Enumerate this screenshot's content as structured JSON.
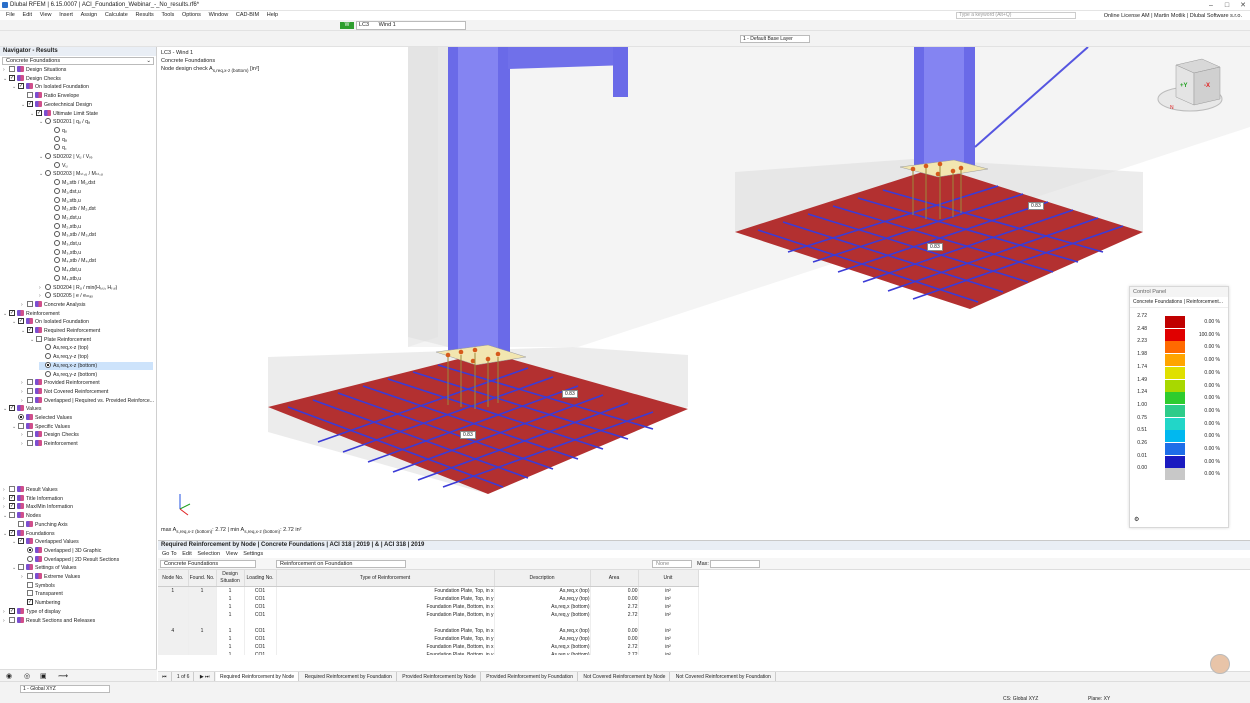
{
  "app": {
    "title": "Dlubal RFEM | 6.15.0007 | ACI_Foundation_Webinar_-_No_results.rf6*",
    "license": "Online License AM | Martin Motlik | Dlubal Software s.r.o.",
    "keyword_placeholder": "Type a keyword (Alt+Q)"
  },
  "menu": [
    "File",
    "Edit",
    "View",
    "Insert",
    "Assign",
    "Calculate",
    "Results",
    "Tools",
    "Options",
    "Window",
    "CAD-BIM",
    "Help"
  ],
  "toolbar": {
    "lc_badge": "W",
    "lc_code": "LC3",
    "lc_name": "Wind 1",
    "layer": "1 - Default Base Layer"
  },
  "navigator": {
    "title": "Navigator - Results",
    "combo": "Concrete Foundations",
    "items": [
      {
        "label": "Design Situations",
        "level": 0,
        "toggle": "›",
        "check": false,
        "icon": "ds"
      },
      {
        "label": "Design Checks",
        "level": 0,
        "toggle": "⌄",
        "check": true,
        "icon": "dc"
      },
      {
        "label": "On Isolated Foundation",
        "level": 1,
        "toggle": "⌄",
        "check": true,
        "icon": "if"
      },
      {
        "label": "Ratio Envelope",
        "level": 2,
        "toggle": "",
        "check": false,
        "icon": "rt"
      },
      {
        "label": "Geotechnical Design",
        "level": 2,
        "toggle": "⌄",
        "check": true,
        "icon": "gd"
      },
      {
        "label": "Ultimate Limit State",
        "level": 3,
        "toggle": "⌄",
        "check": true,
        "icon": "ul"
      },
      {
        "label": "SD0201 | qᵤ / qₐ",
        "level": 4,
        "toggle": "⌄",
        "radio": false
      },
      {
        "label": "qᵤ",
        "level": 5,
        "toggle": "",
        "radio": false
      },
      {
        "label": "qₐ",
        "level": 5,
        "toggle": "",
        "radio": false
      },
      {
        "label": "q꜀",
        "level": 5,
        "toggle": "",
        "radio": false
      },
      {
        "label": "SD0202 | Vᵤ / Vᵣₑ",
        "level": 4,
        "toggle": "⌄",
        "radio": false
      },
      {
        "label": "Vᵤ",
        "level": 5,
        "toggle": "",
        "radio": false
      },
      {
        "label": "SD0203 | Mₛₜ,ᵤ / Mₛₜ,ᵤ",
        "level": 4,
        "toggle": "⌄",
        "radio": false
      },
      {
        "label": "M₁,stb / M₁,dst",
        "level": 5,
        "toggle": "",
        "radio": false
      },
      {
        "label": "M₁,dst,u",
        "level": 5,
        "toggle": "",
        "radio": false
      },
      {
        "label": "M₁,stb,u",
        "level": 5,
        "toggle": "",
        "radio": false
      },
      {
        "label": "M₂,stb / M₂,dst",
        "level": 5,
        "toggle": "",
        "radio": false
      },
      {
        "label": "M₂,dst,u",
        "level": 5,
        "toggle": "",
        "radio": false
      },
      {
        "label": "M₂,stb,u",
        "level": 5,
        "toggle": "",
        "radio": false
      },
      {
        "label": "M₃,stb / M₃,dst",
        "level": 5,
        "toggle": "",
        "radio": false
      },
      {
        "label": "M₃,dst,u",
        "level": 5,
        "toggle": "",
        "radio": false
      },
      {
        "label": "M₃,stb,u",
        "level": 5,
        "toggle": "",
        "radio": false
      },
      {
        "label": "M₄,stb / M₄,dst",
        "level": 5,
        "toggle": "",
        "radio": false
      },
      {
        "label": "M₄,dst,u",
        "level": 5,
        "toggle": "",
        "radio": false
      },
      {
        "label": "M₄,stb,u",
        "level": 5,
        "toggle": "",
        "radio": false
      },
      {
        "label": "SD0204 | Rᵤ / min(Hᵣ,ᵤ, Hᵣ,ᵥ)",
        "level": 4,
        "toggle": "›",
        "radio": false
      },
      {
        "label": "SD0205 | e / eₘₐₓ",
        "level": 4,
        "toggle": "›",
        "radio": false
      },
      {
        "label": "Concrete Analysis",
        "level": 2,
        "toggle": "›",
        "check": false,
        "icon": "ca"
      },
      {
        "label": "Reinforcement",
        "level": 0,
        "toggle": "⌄",
        "check": true,
        "icon": "rf"
      },
      {
        "label": "On Isolated Foundation",
        "level": 1,
        "toggle": "⌄",
        "check": true,
        "icon": "if"
      },
      {
        "label": "Required Reinforcement",
        "level": 2,
        "toggle": "⌄",
        "check": true,
        "icon": "rr"
      },
      {
        "label": "Plate Reinforcement",
        "level": 3,
        "toggle": "⌄",
        "check": false,
        "icon": ""
      },
      {
        "label": "As,req,x-z (top)",
        "level": 4,
        "toggle": "",
        "radio": false
      },
      {
        "label": "As,req,y-z (top)",
        "level": 4,
        "toggle": "",
        "radio": false
      },
      {
        "label": "As,req,x-z (bottom)",
        "level": 4,
        "toggle": "",
        "radio": true,
        "selected": true
      },
      {
        "label": "As,req,y-z (bottom)",
        "level": 4,
        "toggle": "",
        "radio": false
      },
      {
        "label": "Provided Reinforcement",
        "level": 2,
        "toggle": "›",
        "check": false,
        "icon": "pr"
      },
      {
        "label": "Not Covered Reinforcement",
        "level": 2,
        "toggle": "›",
        "check": false,
        "icon": "nc"
      },
      {
        "label": "Overlapped | Required vs. Provided Reinforce...",
        "level": 2,
        "toggle": "›",
        "check": false,
        "icon": "ov"
      },
      {
        "label": "Values",
        "level": 0,
        "toggle": "⌄",
        "check": true,
        "icon": "vl"
      },
      {
        "label": "Selected Values",
        "level": 1,
        "toggle": "",
        "radio": true,
        "icon": "sv"
      },
      {
        "label": "Specific Values",
        "level": 1,
        "toggle": "⌄",
        "check": false,
        "icon": "sp"
      },
      {
        "label": "Design Checks",
        "level": 2,
        "toggle": "›",
        "check": false,
        "icon": "dc"
      },
      {
        "label": "Reinforcement",
        "level": 2,
        "toggle": "›",
        "check": false,
        "icon": "rf"
      }
    ],
    "items2": [
      {
        "label": "Result Values",
        "level": 0,
        "toggle": "›",
        "check": false,
        "icon": "rv"
      },
      {
        "label": "Title Information",
        "level": 0,
        "toggle": "›",
        "check": true,
        "icon": "ti"
      },
      {
        "label": "Max/Min Information",
        "level": 0,
        "toggle": "›",
        "check": true,
        "icon": "mm"
      },
      {
        "label": "Nodes",
        "level": 0,
        "toggle": "⌄",
        "check": false,
        "icon": "nd"
      },
      {
        "label": "Punching Axis",
        "level": 1,
        "toggle": "",
        "check": false,
        "icon": "pa"
      },
      {
        "label": "Foundations",
        "level": 0,
        "toggle": "⌄",
        "check": true,
        "icon": "fd"
      },
      {
        "label": "Overlapped Values",
        "level": 1,
        "toggle": "⌄",
        "check": true,
        "icon": "ov"
      },
      {
        "label": "Overlapped | 3D Graphic",
        "level": 2,
        "toggle": "",
        "radio": true,
        "icon": "g3"
      },
      {
        "label": "Overlapped | 2D Result Sections",
        "level": 2,
        "toggle": "",
        "radio": false,
        "icon": "g2"
      },
      {
        "label": "Settings of Values",
        "level": 1,
        "toggle": "⌄",
        "check": false,
        "icon": "sv"
      },
      {
        "label": "Extreme Values",
        "level": 2,
        "toggle": "›",
        "check": false,
        "icon": "ev"
      },
      {
        "label": "Symbols",
        "level": 2,
        "toggle": "",
        "check": false,
        "icon": ""
      },
      {
        "label": "Transparent",
        "level": 2,
        "toggle": "",
        "check": false,
        "icon": ""
      },
      {
        "label": "Numbering",
        "level": 2,
        "toggle": "",
        "check": true,
        "icon": ""
      },
      {
        "label": "Type of display",
        "level": 0,
        "toggle": "›",
        "check": true,
        "icon": "td"
      },
      {
        "label": "Result Sections and Releases",
        "level": 0,
        "toggle": "›",
        "check": false,
        "icon": "rs"
      }
    ]
  },
  "viewport": {
    "info_lines": [
      "LC3 - Wind 1",
      "Concrete Foundations"
    ],
    "info_check_prefix": "Node design check A",
    "info_check_sub": "s,req,x-z (bottom)",
    "info_check_unit": "[in²]",
    "stat_max": "max A",
    "stat_max_sub": "s,req,x-z (bottom)",
    "stat_max_val": ": 2.72 | min A",
    "stat_min_sub": "s,req,x-z (bottom)",
    "stat_min_val": ": 2.72 in²",
    "labels": [
      "0.83",
      "0.83",
      "0.83",
      "0.83"
    ],
    "cube_labels": {
      "y": "+Y",
      "x": "-X",
      "n": "N"
    }
  },
  "control_panel": {
    "title": "Control Panel",
    "subtitle": "Concrete Foundations | Reinforcement...",
    "legend": [
      {
        "value": "2.72",
        "color": "#c00000",
        "pct": "0.00 %"
      },
      {
        "value": "2.48",
        "color": "#e00000",
        "pct": "100.00 %"
      },
      {
        "value": "2.23",
        "color": "#ff6a00",
        "pct": "0.00 %"
      },
      {
        "value": "1.98",
        "color": "#ffa500",
        "pct": "0.00 %"
      },
      {
        "value": "1.74",
        "color": "#e0e000",
        "pct": "0.00 %"
      },
      {
        "value": "1.49",
        "color": "#a8d800",
        "pct": "0.00 %"
      },
      {
        "value": "1.24",
        "color": "#2ecc2e",
        "pct": "0.00 %"
      },
      {
        "value": "1.00",
        "color": "#2ecc8a",
        "pct": "0.00 %"
      },
      {
        "value": "0.75",
        "color": "#22d6c8",
        "pct": "0.00 %"
      },
      {
        "value": "0.51",
        "color": "#00b8f0",
        "pct": "0.00 %"
      },
      {
        "value": "0.26",
        "color": "#1e6ee8",
        "pct": "0.00 %"
      },
      {
        "value": "0.01",
        "color": "#1a1ac0",
        "pct": "0.00 %"
      },
      {
        "value": "0.00",
        "color": "#c8c8c8",
        "pct": "0.00 %"
      }
    ]
  },
  "panel": {
    "title": "Required Reinforcement by Node | Concrete Foundations | ACI 318 | 2019 | & | ACI 318 | 2019",
    "menu": [
      "Go To",
      "Edit",
      "Selection",
      "View",
      "Settings"
    ],
    "combo1": "Concrete Foundations",
    "combo2": "Reinforcement on Foundation",
    "combo3": "None",
    "max_label": "Max:",
    "headers": [
      "Node No.",
      "Found. No.",
      "Design Situation",
      "Loading No.",
      "Type of Reinforcement",
      "Description",
      "Area",
      "Unit"
    ],
    "rows": [
      [
        "1",
        "1",
        "1",
        "CO1",
        "Foundation Plate, Top, in x",
        "As,req,x (top)",
        "0.00",
        "in²"
      ],
      [
        "",
        "",
        "1",
        "CO1",
        "Foundation Plate, Top, in y",
        "As,req,y (top)",
        "0.00",
        "in²"
      ],
      [
        "",
        "",
        "1",
        "CO1",
        "Foundation Plate, Bottom, in x",
        "As,req,x (bottom)",
        "2.72",
        "in²"
      ],
      [
        "",
        "",
        "1",
        "CO1",
        "Foundation Plate, Bottom, in y",
        "As,req,y (bottom)",
        "2.72",
        "in²"
      ],
      [
        "",
        "",
        "",
        "",
        "",
        "",
        "",
        ""
      ],
      [
        "4",
        "1",
        "1",
        "CO1",
        "Foundation Plate, Top, in x",
        "As,req,x (top)",
        "0.00",
        "in²"
      ],
      [
        "",
        "",
        "1",
        "CO1",
        "Foundation Plate, Top, in y",
        "As,req,y (top)",
        "0.00",
        "in²"
      ],
      [
        "",
        "",
        "1",
        "CO1",
        "Foundation Plate, Bottom, in x",
        "As,req,x (bottom)",
        "2.72",
        "in²"
      ],
      [
        "",
        "",
        "1",
        "CO1",
        "Foundation Plate, Bottom, in y",
        "As,req,y (bottom)",
        "2.72",
        "in²"
      ]
    ],
    "pager": "1 of 6",
    "tabs": [
      "Required Reinforcement by Node",
      "Required Reinforcement by Foundation",
      "Provided Reinforcement by Node",
      "Provided Reinforcement by Foundation",
      "Not Covered Reinforcement by Node",
      "Not Covered Reinforcement by Foundation"
    ]
  },
  "statusbar": {
    "view_combo": "1 - Global XYZ",
    "cs": "CS: Global XYZ",
    "plane": "Plane: XY"
  }
}
